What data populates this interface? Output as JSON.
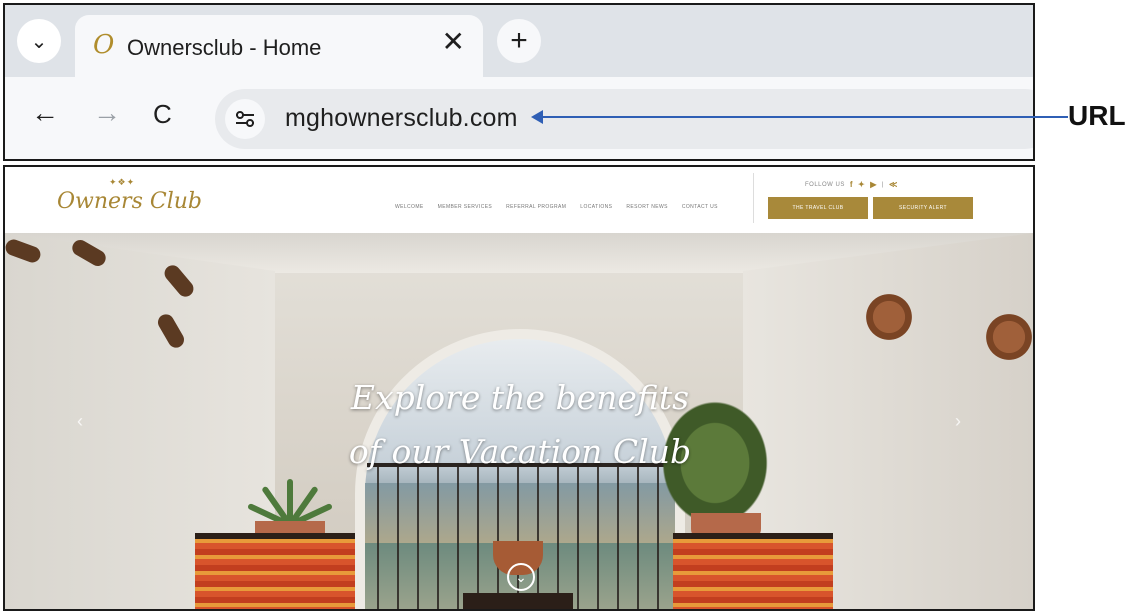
{
  "browser": {
    "tab_dropdown_icon": "chevron-down-icon",
    "tab": {
      "favicon_glyph": "O",
      "title": "Ownersclub - Home",
      "close_glyph": "✕"
    },
    "new_tab_glyph": "+",
    "nav": {
      "back_glyph": "←",
      "forward_glyph": "→",
      "reload_glyph": "C"
    },
    "address_bar": {
      "url": "mghownersclub.com",
      "site_info_icon": "tune-icon"
    }
  },
  "annotation": {
    "label": "URL",
    "color": "#2f5fb5"
  },
  "website": {
    "logo": {
      "crown_text": "✦❖✦",
      "script_text": "Owners Club"
    },
    "nav_items": [
      "Welcome",
      "Member Services",
      "Referral Program",
      "Locations",
      "Resort News",
      "Contact Us"
    ],
    "follow": {
      "label": "FOLLOW US",
      "icons": [
        "f",
        "✦",
        "▶",
        "|",
        "≪"
      ]
    },
    "buttons": {
      "travel_club": "The Travel Club",
      "security_alert": "Security Alert"
    },
    "hero": {
      "title_line1": "Explore the benefits",
      "title_line2": "of our Vacation Club",
      "prev_glyph": "‹",
      "next_glyph": "›",
      "scroll_glyph": "⌄"
    },
    "colors": {
      "gold": "#a8893a"
    }
  }
}
